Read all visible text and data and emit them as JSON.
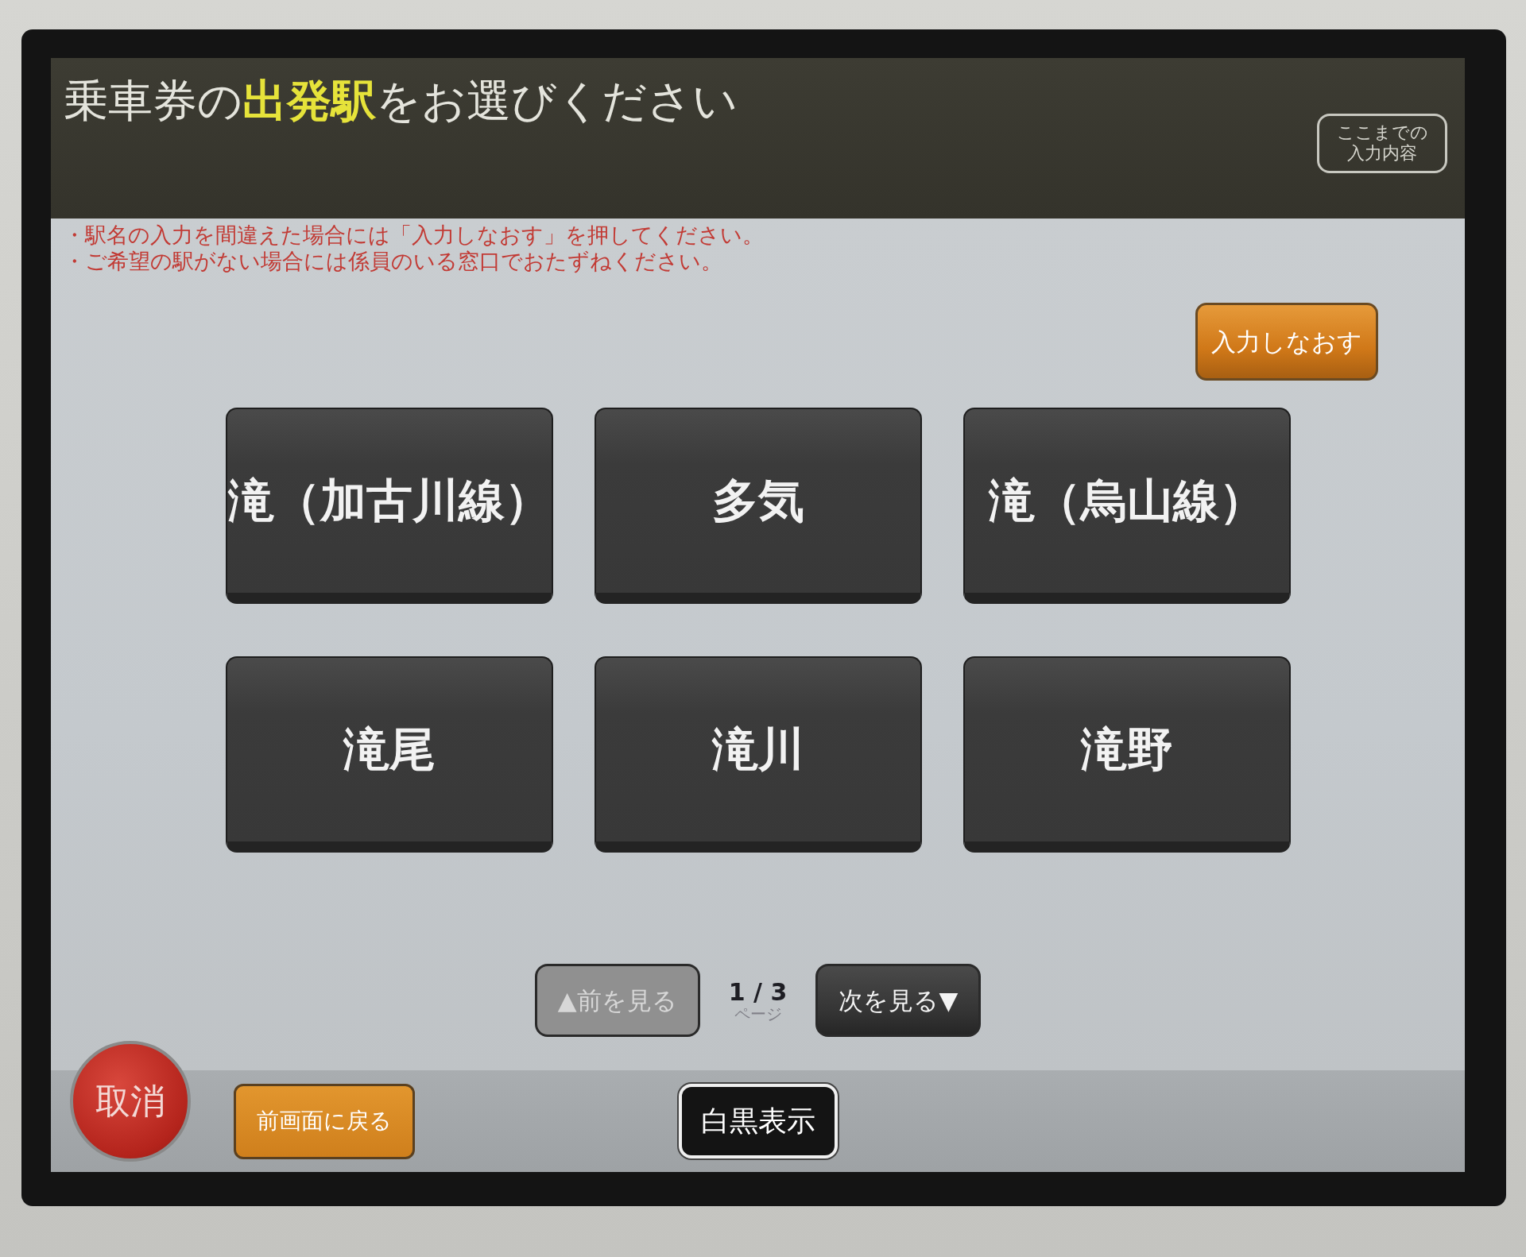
{
  "header": {
    "title": "乗車券の**出発駅**をお選びください",
    "summary_button": "ここまでの入力内容"
  },
  "notices": [
    "・駅名の入力を間違えた場合には「入力しなおす」を押してください。",
    "・ご希望の駅がない場合には係員のいる窓口でおたずねください。"
  ],
  "redo_button": "入力しなおす",
  "stations": [
    {
      "label": "滝（加古川線）"
    },
    {
      "label": "多気"
    },
    {
      "label": "滝（烏山線）"
    },
    {
      "label": "滝尾"
    },
    {
      "label": "滝川"
    },
    {
      "label": "滝野"
    }
  ],
  "pagination": {
    "previous": {
      "label": "▲前を見る",
      "disabled": true
    },
    "page": "1 / 3",
    "page_unit": "ページ",
    "next": {
      "label": "次を見る▼",
      "disabled": false
    }
  },
  "footer": {
    "cancel_button": "取消",
    "back_button": "前画面に戻る",
    "monochrome_button": "白黒表示"
  }
}
